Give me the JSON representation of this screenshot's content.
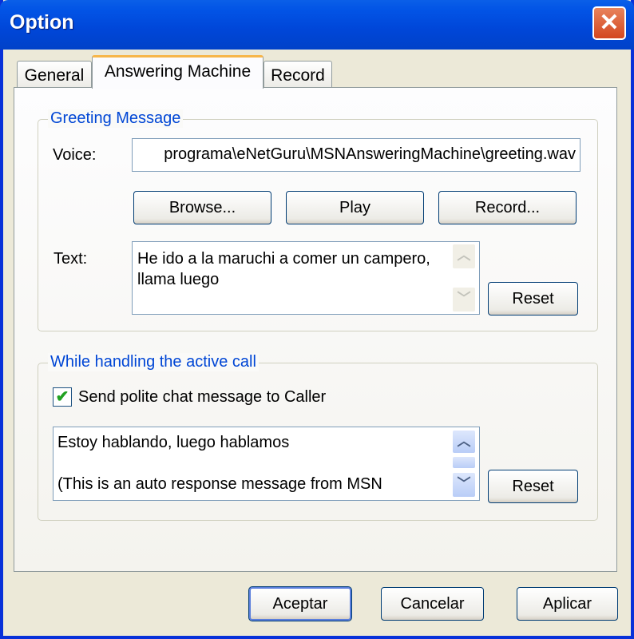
{
  "window": {
    "title": "Option",
    "close_icon": "close-x-icon"
  },
  "tabs": [
    {
      "label": "General"
    },
    {
      "label": "Answering Machine",
      "active": true
    },
    {
      "label": "Record"
    }
  ],
  "greeting": {
    "legend": "Greeting Message",
    "voice_label": "Voice:",
    "voice_value": "programa\\eNetGuru\\MSNAnsweringMachine\\greeting.wav",
    "browse": "Browse...",
    "play": "Play",
    "record": "Record...",
    "text_label": "Text:",
    "text_line1": "He ido a la maruchi a comer un campero,",
    "text_line2": "llama luego",
    "reset": "Reset"
  },
  "active_call": {
    "legend": "While handling the active call",
    "checkbox_label": "Send polite chat message to Caller",
    "checked": true,
    "msg_line1": "Estoy hablando, luego hablamos",
    "msg_line2": "(This is an auto response message from MSN",
    "reset": "Reset"
  },
  "footer": {
    "ok": "Aceptar",
    "cancel": "Cancelar",
    "apply": "Aplicar"
  }
}
